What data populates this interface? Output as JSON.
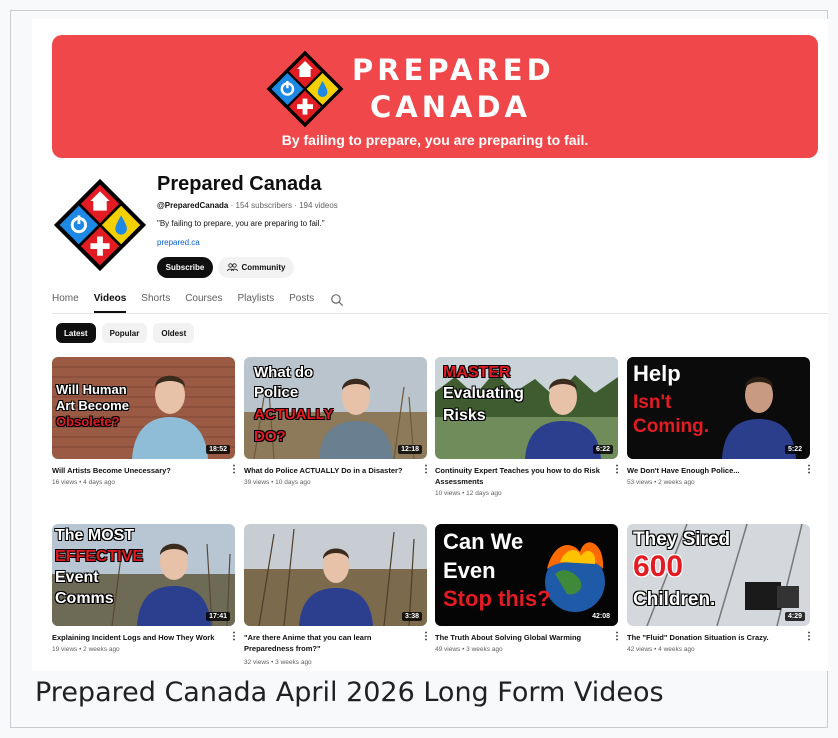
{
  "banner": {
    "title_line1": "PREPARED",
    "title_line2": "CANADA",
    "slogan": "By failing to prepare, you are preparing to fail.",
    "bg_color": "#f0474b"
  },
  "channel": {
    "name": "Prepared Canada",
    "handle": "@PreparedCanada",
    "stats": " · 154 subscribers · 194 videos",
    "description": "\"By failing to prepare, you are preparing to fail.\"",
    "link": "prepared.ca",
    "subscribe_label": "Subscribe",
    "community_label": "Community"
  },
  "tabs": [
    {
      "label": "Home",
      "active": false
    },
    {
      "label": "Videos",
      "active": true
    },
    {
      "label": "Shorts",
      "active": false
    },
    {
      "label": "Courses",
      "active": false
    },
    {
      "label": "Playlists",
      "active": false
    },
    {
      "label": "Posts",
      "active": false
    }
  ],
  "chips": [
    {
      "label": "Latest",
      "active": true
    },
    {
      "label": "Popular",
      "active": false
    },
    {
      "label": "Oldest",
      "active": false
    }
  ],
  "videos": [
    {
      "title": "Will Artists Become Unecessary?",
      "meta": "16 views • 4 days ago",
      "duration": "18:52",
      "overlay": [
        "Will Human",
        "Art Become",
        "Obsolete?"
      ]
    },
    {
      "title": "What do Police ACTUALLY Do in a Disaster?",
      "meta": "39 views • 10 days ago",
      "duration": "12:18",
      "overlay": [
        "What do",
        "Police",
        "ACTUALLY",
        "DO?"
      ]
    },
    {
      "title": "Continuity Expert Teaches you how to do Risk Assessments",
      "meta": "10 views • 12 days ago",
      "duration": "6:22",
      "overlay": [
        "MASTER",
        "Evaluating",
        "Risks"
      ]
    },
    {
      "title": "We Don't Have Enough Police...",
      "meta": "53 views • 2 weeks ago",
      "duration": "5:22",
      "overlay": [
        "Help",
        "Isn't",
        "Coming."
      ]
    },
    {
      "title": "Explaining Incident Logs and How They Work",
      "meta": "19 views • 2 weeks ago",
      "duration": "17:41",
      "overlay": [
        "The MOST",
        "EFFECTIVE",
        "Event",
        "Comms"
      ]
    },
    {
      "title": "\"Are there Anime that you can learn Preparedness from?\"",
      "meta": "32 views • 3 weeks ago",
      "duration": "3:38",
      "overlay": []
    },
    {
      "title": "The Truth About Solving Global Warming",
      "meta": "49 views • 3 weeks ago",
      "duration": "42:08",
      "overlay": [
        "Can We",
        "Even",
        "Stop this?"
      ]
    },
    {
      "title": "The \"Fluid\" Donation Situation is Crazy.",
      "meta": "42 views • 4 weeks ago",
      "duration": "4:29",
      "overlay": [
        "They Sired",
        "600",
        "Children."
      ]
    }
  ],
  "caption": "Prepared Canada April 2026 Long Form Videos",
  "colors": {
    "logo_red": "#e31b23",
    "logo_blue": "#1e88e5",
    "logo_yellow": "#f5d000",
    "link_blue": "#065fd4"
  }
}
